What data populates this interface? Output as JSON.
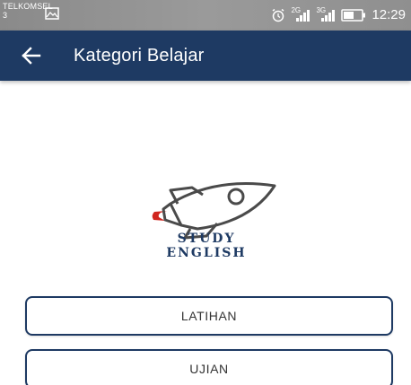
{
  "status_bar": {
    "carrier": "TELKOMSEL",
    "carrier_sub": "3",
    "network_1": "2G",
    "network_2": "3G",
    "time": "12:29",
    "icons": [
      "gallery-icon",
      "alarm-icon",
      "signal-icon",
      "signal-icon",
      "battery-icon"
    ]
  },
  "app_bar": {
    "back_icon": "arrow-left-icon",
    "title": "Kategori Belajar",
    "color": "#1e3a63"
  },
  "logo": {
    "icon": "rocket-icon",
    "line1": "STUDY",
    "line2": "ENGLISH",
    "accent": "#d0261f"
  },
  "menu": {
    "latihan_label": "LATIHAN",
    "ujian_label": "UJIAN"
  }
}
